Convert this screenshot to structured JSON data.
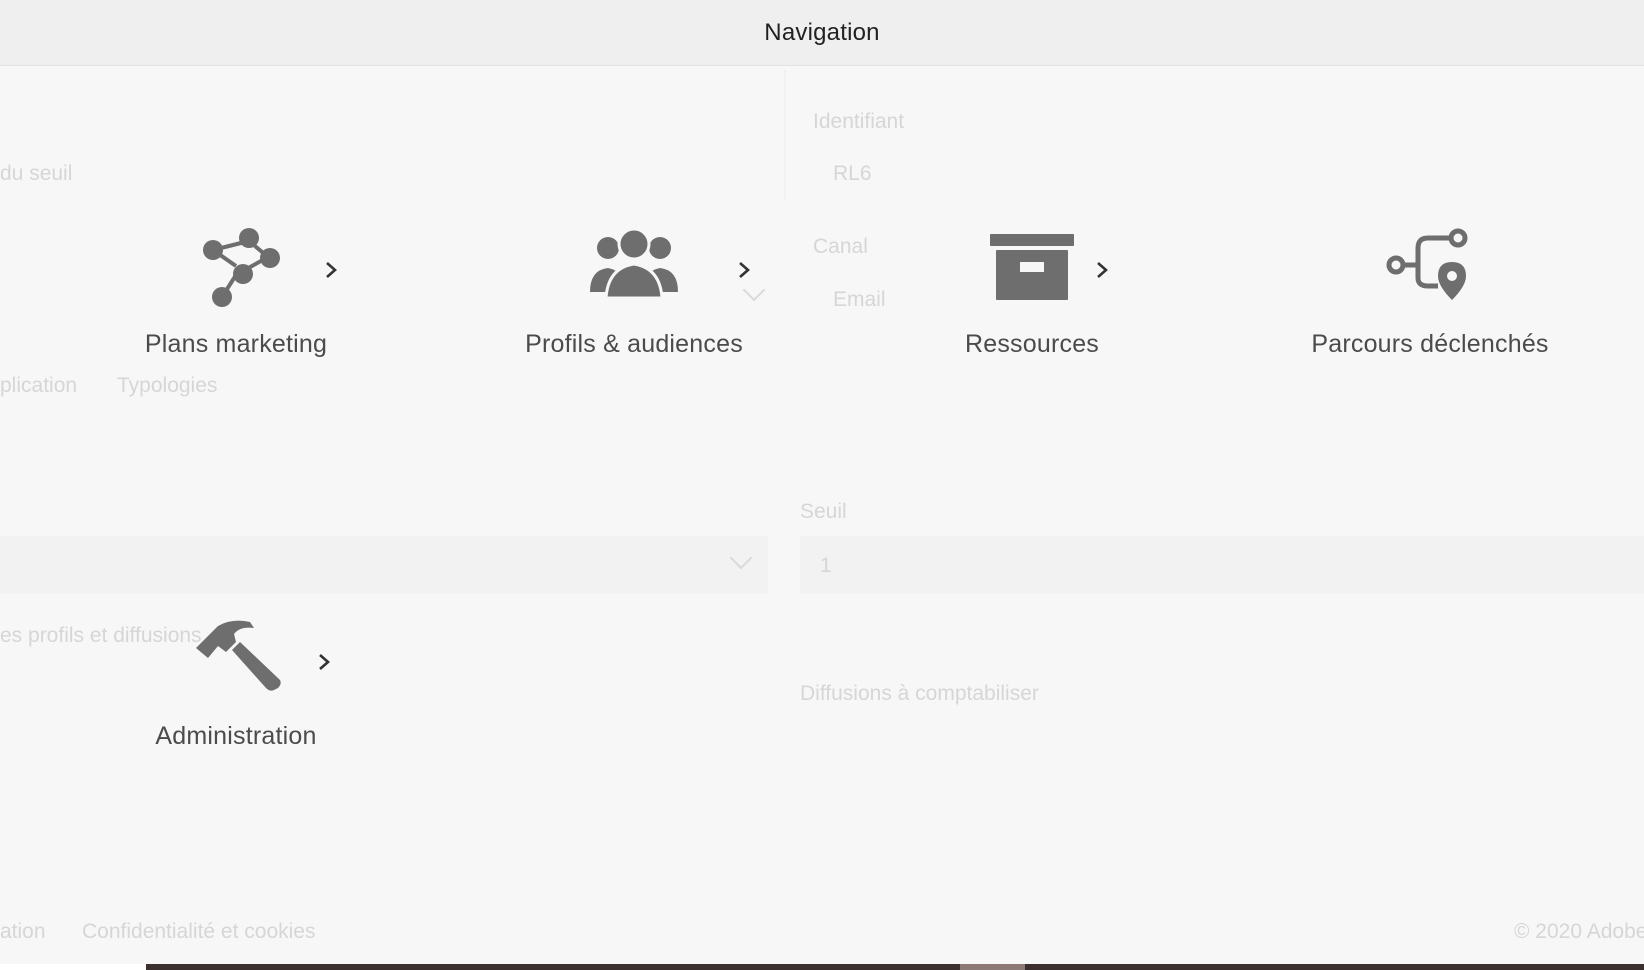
{
  "header": {
    "title": "Navigation"
  },
  "tiles": [
    {
      "label": "Plans marketing",
      "icon": "marketing-plans-icon"
    },
    {
      "label": "Profils & audiences",
      "icon": "audiences-icon"
    },
    {
      "label": "Ressources",
      "icon": "archive-box-icon"
    },
    {
      "label": "Parcours déclenchés",
      "icon": "journey-location-icon"
    },
    {
      "label": "Administration",
      "icon": "hammer-icon"
    }
  ],
  "background": {
    "identifier_label": "Identifiant",
    "identifier_value": "RL6",
    "canal_label": "Canal",
    "canal_value": "Email",
    "threshold_partial": "du seuil",
    "tabs_partial_1": "plication",
    "tabs_partial_2": "Typologies",
    "seuil_label": "Seuil",
    "seuil_value": "1",
    "profiles_partial": "es profils et diffusions",
    "diffusions_label": "Diffusions à comptabiliser",
    "footer_partial": "ation",
    "footer_privacy": "Confidentialité et cookies",
    "footer_copyright": "© 2020 Adobe"
  },
  "colors": {
    "header_bg": "#efefef",
    "icon": "#6e6e6e",
    "label": "#4b4b4b",
    "page_bg": "#f7f7f7"
  }
}
